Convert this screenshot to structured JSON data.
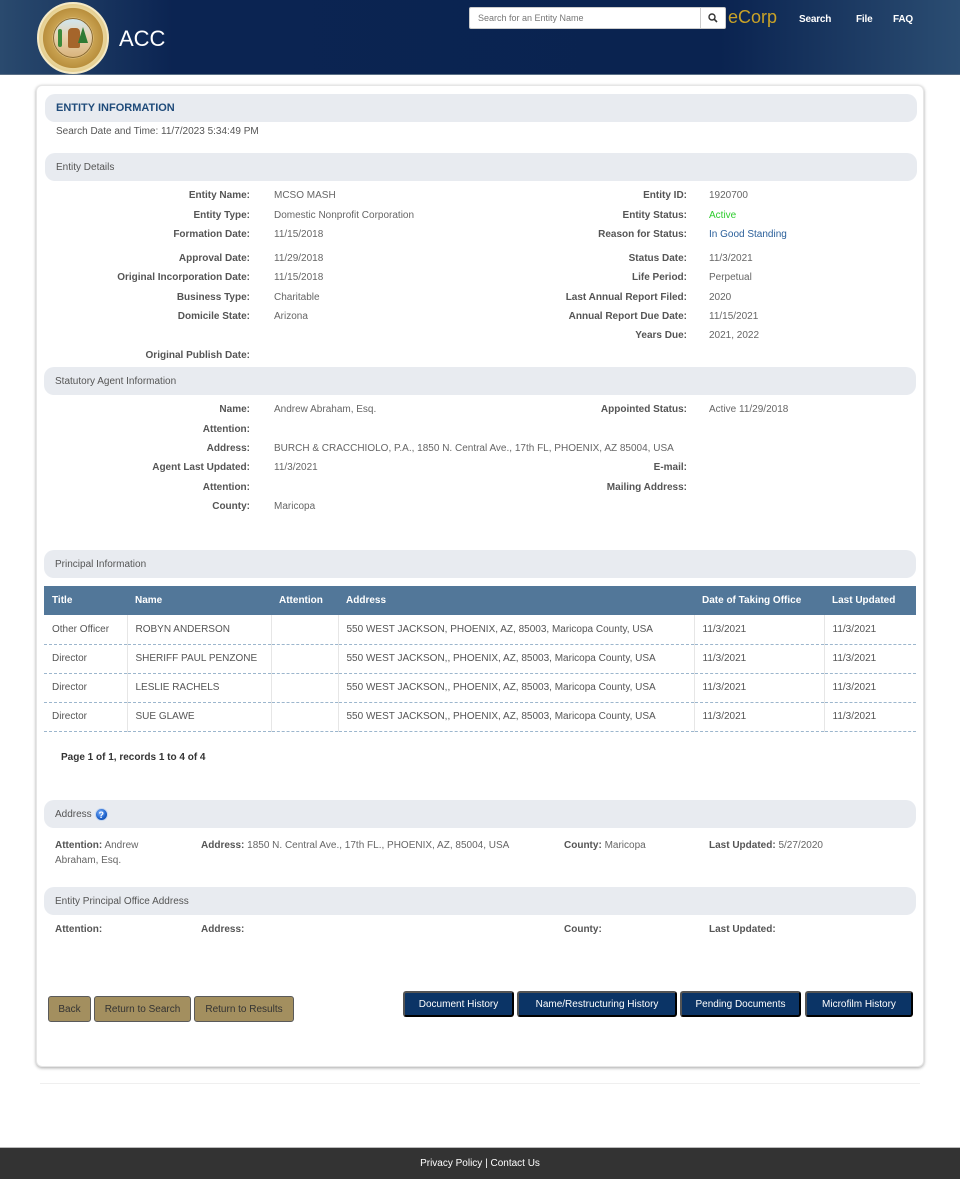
{
  "header": {
    "brand": "ACC",
    "search_placeholder": "Search for an Entity Name",
    "ecorp": "eCorp",
    "nav": [
      "Search",
      "File",
      "FAQ"
    ],
    "icons": {
      "seal": "arizona-corporation-commission-seal",
      "search": "magnifier-icon"
    }
  },
  "entity_information": {
    "title": "ENTITY INFORMATION",
    "search_datetime": "Search Date and Time: 11/7/2023 5:34:49 PM"
  },
  "entity_details": {
    "section_title": "Entity Details",
    "left": [
      {
        "label": "Entity Name:",
        "value": "MCSO MASH"
      },
      {
        "label": "Entity Type:",
        "value": "Domestic Nonprofit Corporation"
      },
      {
        "label": "Formation Date:",
        "value": "11/15/2018"
      },
      {
        "label": "Approval Date:",
        "value": "11/29/2018"
      },
      {
        "label": "Original Incorporation Date:",
        "value": "11/15/2018"
      },
      {
        "label": "Business Type:",
        "value": "Charitable"
      },
      {
        "label": "Domicile State:",
        "value": "Arizona"
      },
      {
        "label": "Original Publish Date:",
        "value": ""
      }
    ],
    "right": [
      {
        "label": "Entity ID:",
        "value": "1920700"
      },
      {
        "label": "Entity Status:",
        "value": "Active"
      },
      {
        "label": "Reason for Status:",
        "value": "In Good Standing"
      },
      {
        "label": "Status Date:",
        "value": "11/3/2021"
      },
      {
        "label": "Life Period:",
        "value": "Perpetual"
      },
      {
        "label": "Last Annual Report Filed:",
        "value": "2020"
      },
      {
        "label": "Annual Report Due Date:",
        "value": "11/15/2021"
      },
      {
        "label": "Years Due:",
        "value": "2021, 2022"
      }
    ],
    "colors": {
      "active": "#2ecc2e",
      "reason": "#2a5f9a"
    }
  },
  "statutory_agent": {
    "section_title": "Statutory Agent Information",
    "left": [
      {
        "label": "Name:",
        "value": "Andrew Abraham, Esq."
      },
      {
        "label": "Attention:",
        "value": ""
      },
      {
        "label": "Address:",
        "value": "BURCH & CRACCHIOLO, P.A., 1850 N. Central Ave., 17th FL, PHOENIX, AZ 85004, USA"
      },
      {
        "label": "Agent Last Updated:",
        "value": "11/3/2021"
      },
      {
        "label": "Attention:",
        "value": ""
      },
      {
        "label": "County:",
        "value": "Maricopa"
      }
    ],
    "right": [
      {
        "label": "Appointed Status:",
        "value": "Active 11/29/2018"
      },
      {
        "label": "E-mail:",
        "value": ""
      },
      {
        "label": "Mailing Address:",
        "value": ""
      }
    ]
  },
  "principal_information": {
    "section_title": "Principal Information",
    "columns": [
      "Title",
      "Name",
      "Attention",
      "Address",
      "Date of Taking Office",
      "Last Updated"
    ],
    "rows": [
      [
        "Other Officer",
        "ROBYN ANDERSON",
        "",
        "550 WEST JACKSON, PHOENIX, AZ, 85003, Maricopa County, USA",
        "11/3/2021",
        "11/3/2021"
      ],
      [
        "Director",
        "SHERIFF PAUL PENZONE",
        "",
        "550 WEST JACKSON,, PHOENIX, AZ, 85003, Maricopa County, USA",
        "11/3/2021",
        "11/3/2021"
      ],
      [
        "Director",
        "LESLIE RACHELS",
        "",
        "550 WEST JACKSON,, PHOENIX, AZ, 85003, Maricopa County, USA",
        "11/3/2021",
        "11/3/2021"
      ],
      [
        "Director",
        "SUE GLAWE",
        "",
        "550 WEST JACKSON,, PHOENIX, AZ, 85003, Maricopa County, USA",
        "11/3/2021",
        "11/3/2021"
      ]
    ],
    "pager": "Page 1 of 1, records 1 to 4 of 4",
    "header_color": "#527799"
  },
  "address": {
    "section_title": "Address",
    "attention_label": "Attention:",
    "attention_value": "Andrew Abraham, Esq.",
    "address_label": "Address:",
    "address_value": "1850 N. Central Ave., 17th FL., PHOENIX, AZ, 85004, USA",
    "county_label": "County:",
    "county_value": "Maricopa",
    "last_updated_label": "Last Updated:",
    "last_updated_value": "5/27/2020"
  },
  "principal_office": {
    "section_title": "Entity Principal Office Address",
    "attention_label": "Attention:",
    "address_label": "Address:",
    "county_label": "County:",
    "last_updated_label": "Last Updated:"
  },
  "buttons": {
    "back": "Back",
    "return_search": "Return to Search",
    "return_results": "Return to Results",
    "document_history": "Document History",
    "name_history": "Name/Restructuring History",
    "pending_documents": "Pending Documents",
    "microfilm_history": "Microfilm History"
  },
  "footer": {
    "privacy": "Privacy Policy",
    "separator": " | ",
    "contact": "Contact Us"
  }
}
